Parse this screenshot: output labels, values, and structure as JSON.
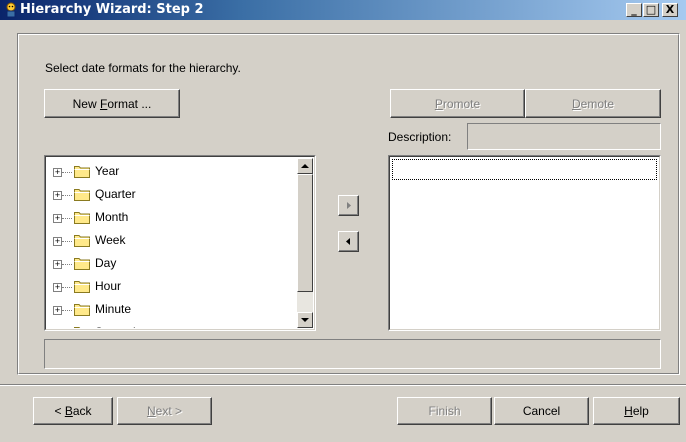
{
  "window": {
    "title": "Hierarchy Wizard: Step 2",
    "controls": {
      "minimize": "_",
      "maximize": "□",
      "close": "X"
    }
  },
  "instructions": "Select date formats for the hierarchy.",
  "new_format_button": {
    "prefix": "New ",
    "accel": "F",
    "suffix": "ormat ..."
  },
  "promote_button": {
    "accel": "P",
    "rest": "romote"
  },
  "demote_button": {
    "accel": "D",
    "rest": "emote"
  },
  "description_label": "Description:",
  "description_value": "",
  "tree": {
    "items": [
      {
        "label": "Year"
      },
      {
        "label": "Quarter"
      },
      {
        "label": "Month"
      },
      {
        "label": "Week"
      },
      {
        "label": "Day"
      },
      {
        "label": "Hour"
      },
      {
        "label": "Minute"
      },
      {
        "label": "Second"
      }
    ]
  },
  "move_right_icon": "right-arrow-icon",
  "move_left_icon": "left-arrow-icon",
  "status_text": "",
  "footer": {
    "back": {
      "prefix": "< ",
      "accel": "B",
      "rest": "ack"
    },
    "next": {
      "accel": "N",
      "rest": "ext >"
    },
    "finish": "Finish",
    "cancel": "Cancel",
    "help": {
      "accel": "H",
      "rest": "elp"
    }
  },
  "colors": {
    "face": "#d4d0c8",
    "title_start": "#0a246a",
    "title_end": "#a6caf0",
    "disabled_text": "#808080"
  }
}
